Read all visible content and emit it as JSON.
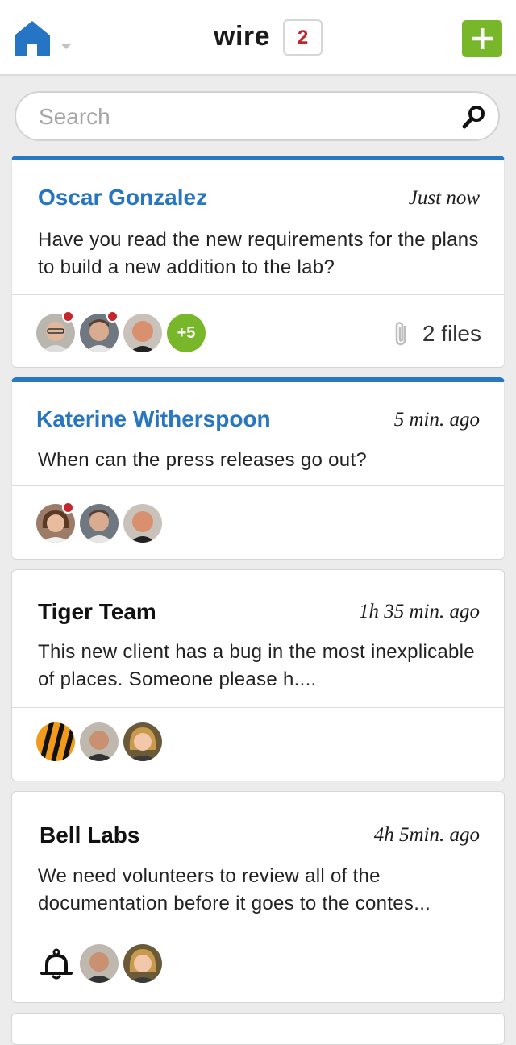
{
  "header": {
    "home_icon": "home-icon",
    "menu_icon": "caret-down-icon",
    "app_name": "wire",
    "unread_count": "2",
    "add_icon": "plus-icon",
    "accent_color": "#78b72a",
    "home_color": "#2575c4"
  },
  "search": {
    "placeholder": "Search",
    "icon": "search-icon"
  },
  "conversations": [
    {
      "sender": "Oscar Gonzalez",
      "time": "Just now",
      "message": "Have you read the new requirements for the plans to build a new addition to the lab?",
      "unread": true,
      "participants_more": "+5",
      "attachments": "2 files",
      "attachment_icon": "paperclip-icon"
    },
    {
      "sender": "Katerine Witherspoon",
      "time": "5 min. ago",
      "message": "When can the press releases go out?",
      "unread": true
    },
    {
      "sender": "Tiger Team",
      "time": "1h 35 min. ago",
      "message": "This new client has a bug in the most inexplicable of places. Someone please h....",
      "unread": false
    },
    {
      "sender": "Bell Labs",
      "time": "4h 5min. ago",
      "message": "We need volunteers to review all of the documentation before it goes to the contes...",
      "unread": false,
      "channel_icon": "bell-icon"
    }
  ],
  "colors": {
    "unread_accent": "#2878c4",
    "presence_dot": "#c3272d",
    "badge_text": "#c0272d"
  }
}
